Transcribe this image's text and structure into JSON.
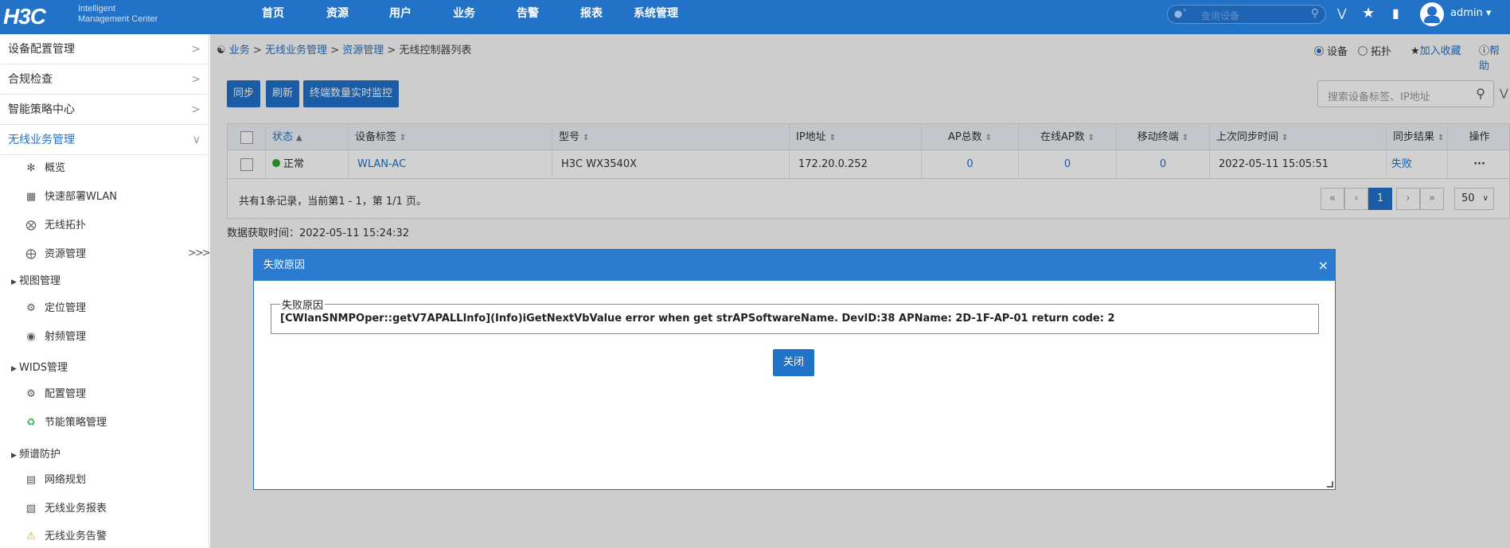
{
  "header": {
    "logo_main": "H3C",
    "logo_sub_1": "Intelligent",
    "logo_sub_2": "Management Center",
    "nav": [
      "首页",
      "资源",
      "用户",
      "业务",
      "告警",
      "报表",
      "系统管理"
    ],
    "search_placeholder": "查询设备",
    "user": "admin"
  },
  "sidebar": {
    "sections": [
      {
        "label": "设备配置管理"
      },
      {
        "label": "合规检查"
      },
      {
        "label": "智能策略中心"
      },
      {
        "label": "无线业务管理"
      }
    ],
    "items": [
      {
        "label": "概览",
        "icon": "antenna-icon"
      },
      {
        "label": "快速部署WLAN",
        "icon": "deploy-icon"
      },
      {
        "label": "无线拓扑",
        "icon": "topology-icon"
      },
      {
        "label": "资源管理",
        "icon": "resource-icon"
      },
      {
        "label": "视图管理",
        "group": true
      },
      {
        "label": "定位管理",
        "icon": "locate-icon"
      },
      {
        "label": "射频管理",
        "icon": "radio-icon"
      },
      {
        "label": "WIDS管理",
        "group": true
      },
      {
        "label": "配置管理",
        "icon": "config-icon"
      },
      {
        "label": "节能策略管理",
        "icon": "recycle-icon"
      },
      {
        "label": "频谱防护",
        "group": true
      },
      {
        "label": "网络规划",
        "icon": "plan-icon"
      },
      {
        "label": "无线业务报表",
        "icon": "report-icon"
      },
      {
        "label": "无线业务告警",
        "icon": "warning-icon"
      }
    ]
  },
  "breadcrumb": {
    "items": [
      "业务",
      "无线业务管理",
      "资源管理"
    ],
    "current": "无线控制器列表",
    "sep": ">"
  },
  "view": {
    "device": "设备",
    "topology": "拓扑",
    "favorite": "加入收藏",
    "help": "帮助"
  },
  "toolbar": {
    "sync": "同步",
    "refresh": "刷新",
    "monitor": "终端数量实时监控",
    "search_placeholder": "搜索设备标签、IP地址"
  },
  "table": {
    "headers": [
      "状态",
      "设备标签",
      "型号",
      "IP地址",
      "AP总数",
      "在线AP数",
      "移动终端",
      "上次同步时间",
      "同步结果",
      "操作"
    ],
    "rows": [
      {
        "status": "正常",
        "label": "WLAN-AC",
        "model": "H3C WX3540X",
        "ip": "172.20.0.252",
        "ap_total": "0",
        "ap_online": "0",
        "mobile": "0",
        "last_sync": "2022-05-11 15:05:51",
        "sync_result": "失败",
        "ops": "···"
      }
    ]
  },
  "pager": {
    "summary": "共有1条记录，当前第1 - 1，第 1/1 页。",
    "current": "1",
    "page_size": "50"
  },
  "fetch_time": "数据获取时间：2022-05-11 15:24:32",
  "modal": {
    "title": "失败原因",
    "legend": "失败原因",
    "reason": "[CWlanSNMPOper::getV7APALLInfo](Info)iGetNextVbValue error when get strAPSoftwareName. DevID:38 APName: 2D-1F-AP-01 return code: 2",
    "close": "关闭"
  },
  "colors": {
    "accent": "#2272c8",
    "status_ok": "#2ea82e"
  }
}
